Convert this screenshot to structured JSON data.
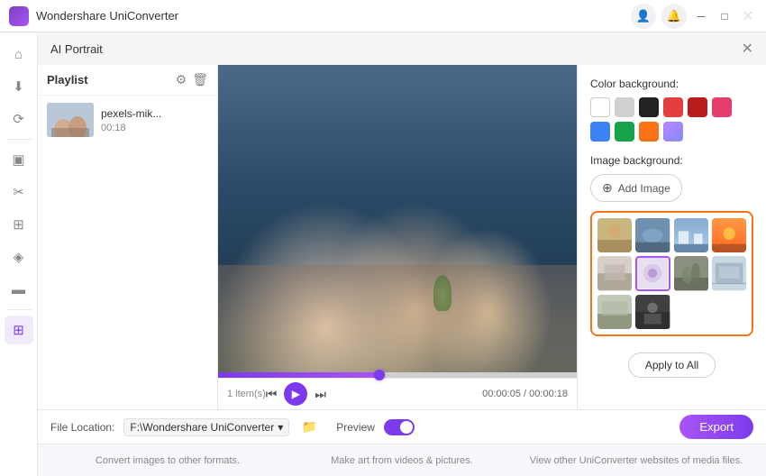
{
  "app": {
    "name": "Wondershare UniConverter",
    "panel_title": "AI Portrait"
  },
  "title_bar": {
    "icons": [
      "user-icon",
      "bell-icon"
    ],
    "controls": [
      "minimize",
      "maximize",
      "close"
    ]
  },
  "playlist": {
    "title": "Playlist",
    "item_name": "pexels-mik...",
    "item_duration": "00:18",
    "items_count": "1 item(s)"
  },
  "video": {
    "time_current": "00:00:05",
    "time_total": "00:00:18"
  },
  "file_location": {
    "label": "File Location:",
    "path": "F:\\Wondershare UniConverter",
    "preview_label": "Preview"
  },
  "right_panel": {
    "color_bg_label": "Color background:",
    "image_bg_label": "Image background:",
    "add_image_label": "Add Image",
    "apply_all_label": "Apply to All",
    "export_label": "Export"
  },
  "colors": [
    {
      "id": "white",
      "hex": "#ffffff",
      "border": "#cccccc"
    },
    {
      "id": "light-gray",
      "hex": "#d0d0d0"
    },
    {
      "id": "black",
      "hex": "#222222"
    },
    {
      "id": "red",
      "hex": "#e53e3e"
    },
    {
      "id": "dark-red",
      "hex": "#b91c1c"
    },
    {
      "id": "pink-red",
      "hex": "#d63b6e"
    },
    {
      "id": "blue",
      "hex": "#3b82f6"
    },
    {
      "id": "green",
      "hex": "#16a34a"
    },
    {
      "id": "orange",
      "hex": "#f97316"
    },
    {
      "id": "purple-gradient",
      "hex": "linear"
    }
  ],
  "notification_bar": {
    "items": [
      "Convert images to other formats.",
      "Make art from videos & pictures.",
      "View other UniConverter websites of media files."
    ]
  },
  "sidebar": {
    "items": [
      {
        "id": "home",
        "icon": "⌂",
        "active": false
      },
      {
        "id": "download",
        "icon": "↓",
        "active": false
      },
      {
        "id": "convert",
        "icon": "◉",
        "active": false
      },
      {
        "id": "compress",
        "icon": "⊞",
        "active": false
      },
      {
        "id": "edit",
        "icon": "✂",
        "active": false
      },
      {
        "id": "merge",
        "icon": "⊟",
        "active": false
      },
      {
        "id": "watermark",
        "icon": "◈",
        "active": false
      },
      {
        "id": "subtitle",
        "icon": "◫",
        "active": false
      },
      {
        "id": "toolbox",
        "icon": "⊞",
        "active": true
      }
    ]
  }
}
